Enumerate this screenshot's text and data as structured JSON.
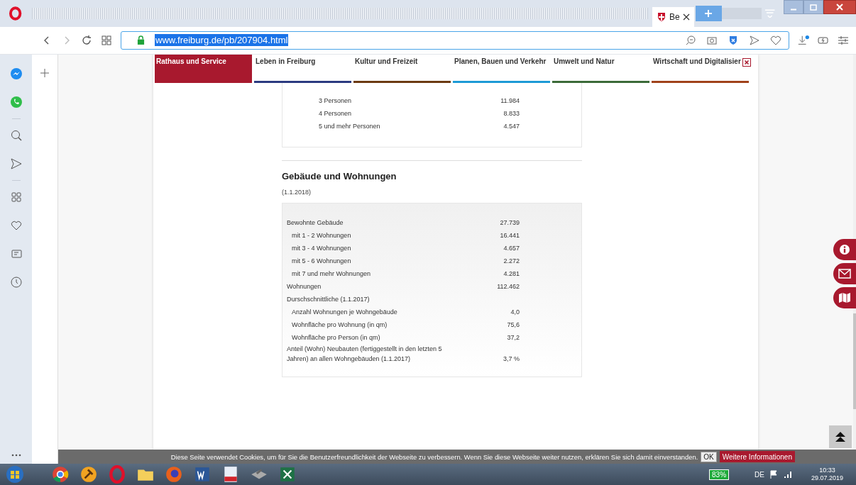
{
  "browser": {
    "tab_title": "Be",
    "url": "www.freiburg.de/pb/207904.html"
  },
  "nav": [
    {
      "label": "Rathaus und Service",
      "selected": true,
      "color": "#a8192e"
    },
    {
      "label": "Leben in Freiburg",
      "selected": false,
      "color": "#2b3a80"
    },
    {
      "label": "Kultur und Freizeit",
      "selected": false,
      "color": "#6b3a12"
    },
    {
      "label": "Planen, Bauen und Verkehr",
      "selected": false,
      "color": "#1d9ad6"
    },
    {
      "label": "Umwelt und Natur",
      "selected": false,
      "color": "#3b6a38"
    },
    {
      "label": "Wirtschaft und Digitalisier",
      "selected": false,
      "color": "#a0421a"
    }
  ],
  "household_rows": [
    {
      "label": "3 Personen",
      "value": "11.984"
    },
    {
      "label": "4 Personen",
      "value": "8.833"
    },
    {
      "label": "5 und mehr Personen",
      "value": "4.547"
    }
  ],
  "section": {
    "title": "Gebäude und Wohnungen",
    "date": "(1.1.2018)",
    "rows": [
      {
        "kind": "main",
        "label": "Bewohnte Gebäude",
        "value": "27.739"
      },
      {
        "kind": "sub",
        "label": "mit 1 - 2 Wohnungen",
        "value": "16.441"
      },
      {
        "kind": "sub",
        "label": "mit 3 - 4 Wohnungen",
        "value": "4.657"
      },
      {
        "kind": "sub",
        "label": "mit 5 - 6 Wohnungen",
        "value": "2.272"
      },
      {
        "kind": "sub",
        "label": "mit 7 und mehr Wohnungen",
        "value": "4.281"
      },
      {
        "kind": "main",
        "label": "Wohnungen",
        "value": "112.462"
      },
      {
        "kind": "main",
        "label": "Durschschnittliche (1.1.2017)"
      },
      {
        "kind": "sub",
        "label": "Anzahl Wohnungen je Wohngebäude",
        "value": "4,0"
      },
      {
        "kind": "sub",
        "label": "Wohnfläche pro Wohnung (in qm)",
        "value": "75,6"
      },
      {
        "kind": "sub",
        "label": "Wohnfläche pro Person (in qm)",
        "value": "37,2"
      },
      {
        "kind": "main",
        "label": "Anteil  (Wohn) Neubauten (fertiggestellt in den letzten 5 Jahren) an allen Wohngebäuden (1.1.2017)",
        "value": "3,7 %"
      }
    ]
  },
  "cookie": {
    "text": "Diese Seite verwendet Cookies, um für Sie die Benutzerfreundlichkeit der Webseite zu verbessern. Wenn Sie diese Webseite weiter nutzen, erklären Sie sich damit einverstanden.",
    "ok": "OK",
    "more": "Weitere Informationen"
  },
  "taskbar": {
    "battery": "83%",
    "language": "DE",
    "time": "10:33",
    "date": "29.07.2019"
  }
}
